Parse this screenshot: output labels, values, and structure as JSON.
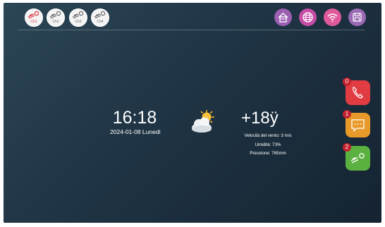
{
  "channels": [
    {
      "label": "Ch1",
      "active": true
    },
    {
      "label": "Ch2",
      "active": false
    },
    {
      "label": "Ch3",
      "active": false
    },
    {
      "label": "Ch4",
      "active": false
    }
  ],
  "toolbar": {
    "home_icon": "home-icon",
    "globe_icon": "globe-icon",
    "wifi_icon": "wifi-icon",
    "save_icon": "save-icon",
    "color": "#b04fa8"
  },
  "clock": {
    "time": "16:18",
    "date": "2024-01-08 Lunedì"
  },
  "weather": {
    "icon": "partly-cloudy-icon",
    "temperature": "+18ÿ",
    "wind": "Velocità del vento: 3 m/s",
    "humidity": "Umidità: 73%",
    "pressure": "Pressione: 765mm"
  },
  "actions": [
    {
      "icon": "phone-icon",
      "count": "0",
      "color": "#e23c43"
    },
    {
      "icon": "message-icon",
      "count": "1",
      "color": "#e79a2a"
    },
    {
      "icon": "monitor-icon",
      "count": "2",
      "color": "#5bb140"
    }
  ]
}
